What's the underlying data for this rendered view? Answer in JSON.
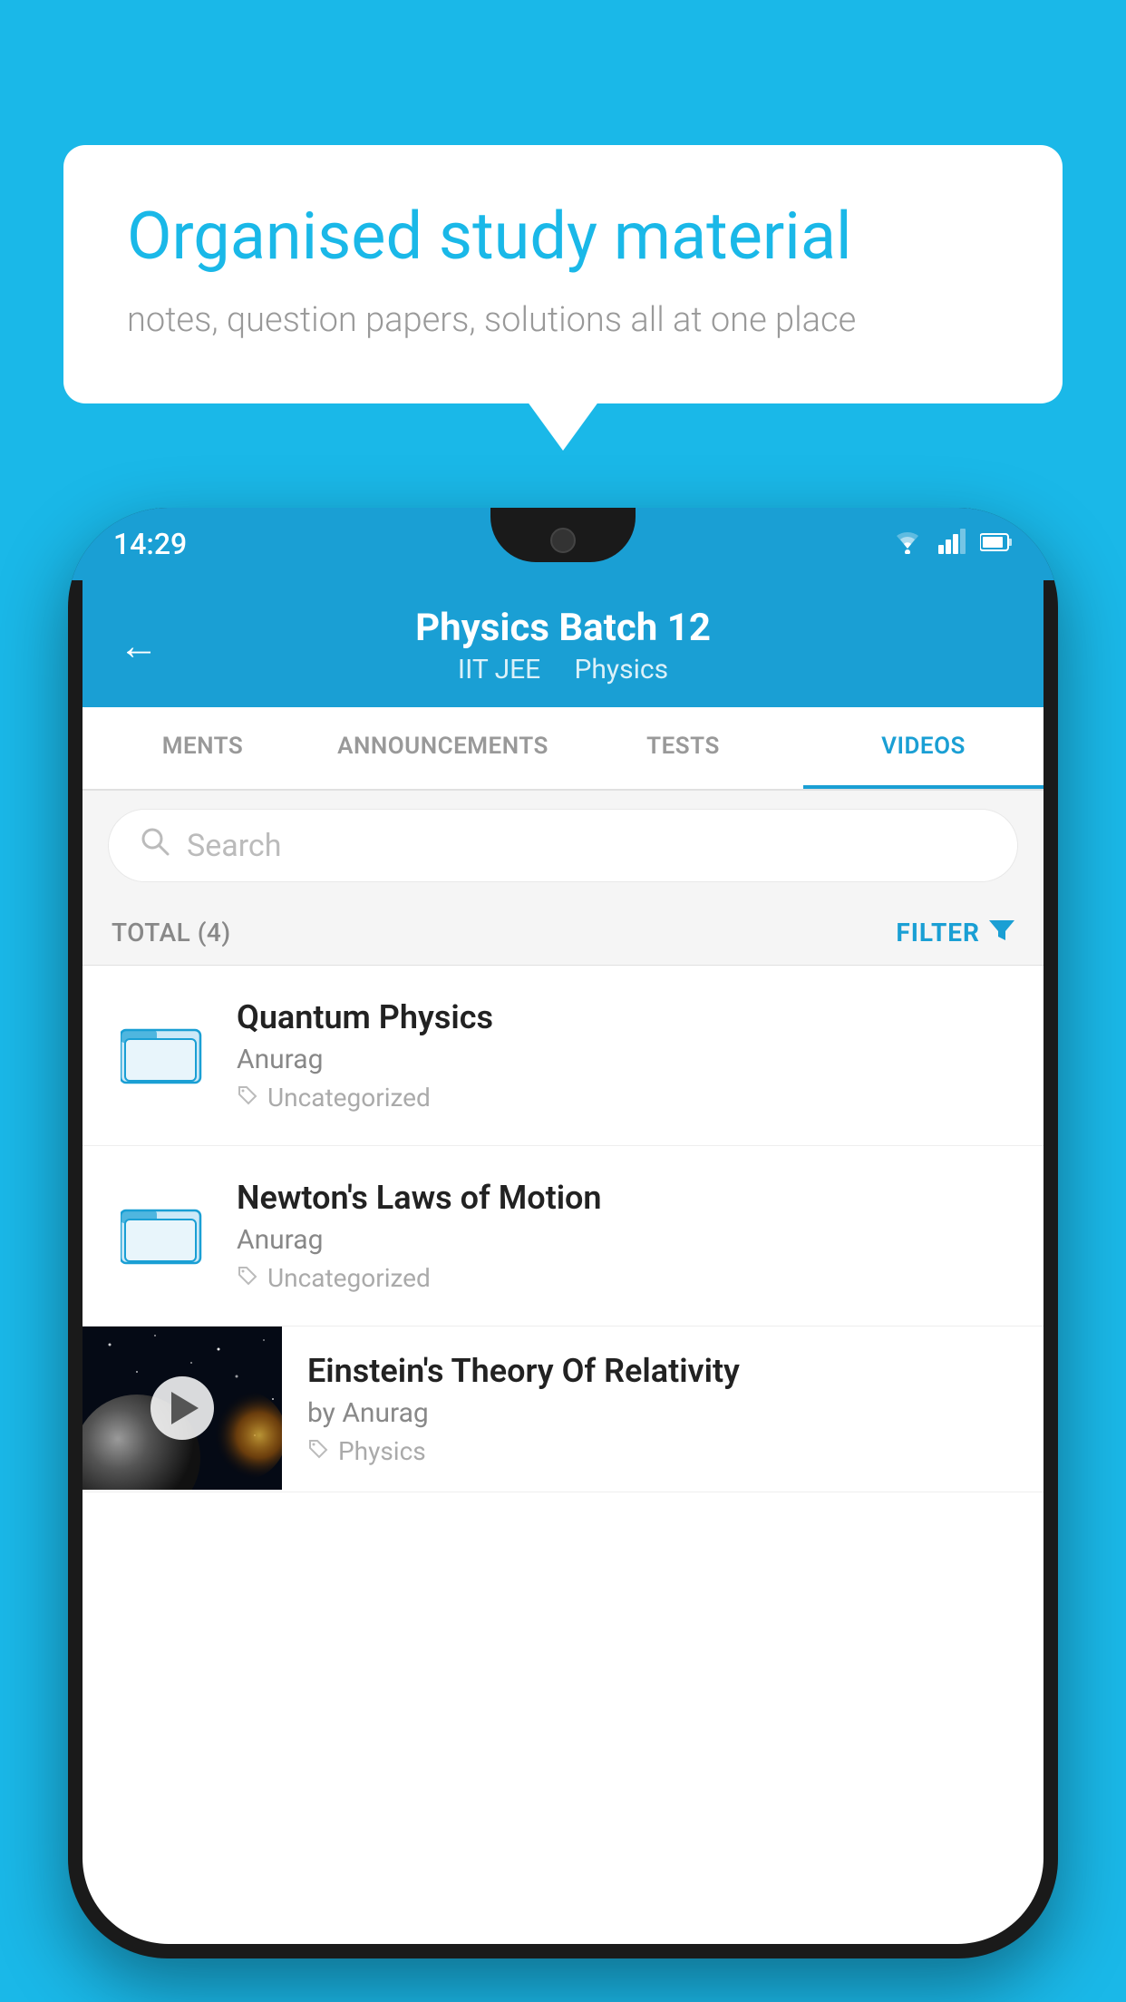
{
  "background": {
    "color": "#1ab8e8"
  },
  "speech_bubble": {
    "title": "Organised study material",
    "subtitle": "notes, question papers, solutions all at one place"
  },
  "phone": {
    "status_bar": {
      "time": "14:29",
      "wifi_icon": "wifi",
      "signal_icon": "signal",
      "battery_icon": "battery"
    },
    "app_header": {
      "back_label": "←",
      "title": "Physics Batch 12",
      "subtitle_part1": "IIT JEE",
      "subtitle_sep": "   ",
      "subtitle_part2": "Physics"
    },
    "tabs": [
      {
        "label": "MENTS",
        "active": false
      },
      {
        "label": "ANNOUNCEMENTS",
        "active": false
      },
      {
        "label": "TESTS",
        "active": false
      },
      {
        "label": "VIDEOS",
        "active": true
      }
    ],
    "search": {
      "placeholder": "Search"
    },
    "filter_row": {
      "total_label": "TOTAL (4)",
      "filter_label": "FILTER"
    },
    "video_items": [
      {
        "id": 1,
        "title": "Quantum Physics",
        "author": "Anurag",
        "tag": "Uncategorized",
        "has_thumbnail": false
      },
      {
        "id": 2,
        "title": "Newton's Laws of Motion",
        "author": "Anurag",
        "tag": "Uncategorized",
        "has_thumbnail": false
      },
      {
        "id": 3,
        "title": "Einstein's Theory Of Relativity",
        "author": "by Anurag",
        "tag": "Physics",
        "has_thumbnail": true
      }
    ]
  }
}
